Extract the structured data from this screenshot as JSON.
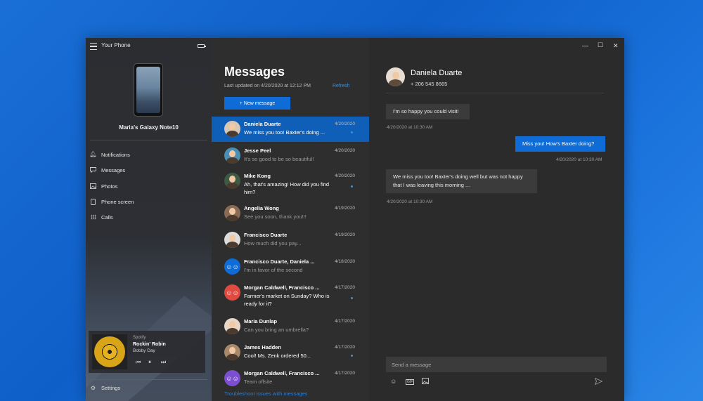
{
  "app": {
    "title": "Your Phone"
  },
  "sidebar": {
    "device_name": "Maria's Galaxy Note10",
    "items": [
      {
        "label": "Notifications",
        "icon": "bell-icon"
      },
      {
        "label": "Messages",
        "icon": "chat-icon"
      },
      {
        "label": "Photos",
        "icon": "photo-icon"
      },
      {
        "label": "Phone screen",
        "icon": "phone-screen-icon"
      },
      {
        "label": "Calls",
        "icon": "dialpad-icon"
      }
    ],
    "media": {
      "source": "Spotify",
      "song": "Rockin' Robin",
      "artist": "Bobby Day"
    },
    "settings_label": "Settings"
  },
  "messages": {
    "title": "Messages",
    "last_updated": "Last updated on 4/20/2020 at 12:12 PM",
    "refresh": "Refresh",
    "new_message": "+ New message",
    "troubleshoot": "Troubleshoot issues with messages",
    "conversations": [
      {
        "name": "Daniela Duarte",
        "date": "4/20/2020",
        "preview": "We miss you too! Baxter's doing ...",
        "unread": true,
        "selected": true,
        "avatar_color": "#d9c7b5"
      },
      {
        "name": "Jesse Peel",
        "date": "4/20/2020",
        "preview": "It's so good to be so beautiful!",
        "unread": false,
        "avatar_color": "#4a8fb8"
      },
      {
        "name": "Mike Kong",
        "date": "4/20/2020",
        "preview": "Ah, that's amazing! How did you find him?",
        "unread": true,
        "avatar_color": "#3d5a44"
      },
      {
        "name": "Angelia Wong",
        "date": "4/19/2020",
        "preview": "See you soon, thank you!!!",
        "unread": false,
        "avatar_color": "#8a6b56"
      },
      {
        "name": "Francisco Duarte",
        "date": "4/19/2020",
        "preview": "How much did you pay...",
        "unread": false,
        "avatar_color": "#dcdcdc"
      },
      {
        "name": "Francisco Duarte, Daniela ...",
        "date": "4/18/2020",
        "preview": "I'm in favor of the second",
        "unread": false,
        "avatar_color": "#0f6cd6",
        "group": true
      },
      {
        "name": "Morgan Caldwell, Francisco ...",
        "date": "4/17/2020",
        "preview": "Farmer's market on Sunday? Who is ready for it?",
        "unread": true,
        "avatar_color": "#e04a3f",
        "group": true
      },
      {
        "name": "Maria Dunlap",
        "date": "4/17/2020",
        "preview": "Can you bring an umbrella?",
        "unread": false,
        "avatar_color": "#e7d7c8"
      },
      {
        "name": "James Hadden",
        "date": "4/17/2020",
        "preview": "Cool! Ms. Zenk ordered 50...",
        "unread": true,
        "avatar_color": "#a88a6a"
      },
      {
        "name": "Morgan Caldwell, Francisco ...",
        "date": "4/17/2020",
        "preview": "Team offsite",
        "unread": false,
        "avatar_color": "#7b4fd0",
        "group": true
      }
    ]
  },
  "conversation": {
    "contact_name": "Daniela Duarte",
    "contact_phone": "+ 206 545 8665",
    "bubbles": [
      {
        "text": "I'm so happy you could visit!",
        "time": "4/20/2020 at 10:30 AM",
        "direction": "in"
      },
      {
        "text": "Miss you! How's Baxter doing?",
        "time": "4/20/2020 at 10:30 AM",
        "direction": "out"
      },
      {
        "text": "We miss you too! Baxter's doing well but was not happy that I was leaving this morning ...",
        "time": "4/20/2020 at 10:30 AM",
        "direction": "in"
      }
    ],
    "input_placeholder": "Send a message",
    "gif_label": "GIF"
  },
  "colors": {
    "accent": "#0f6cd6",
    "unread_dot": "#3d8fe0",
    "selected_row": "#0f5fb8"
  }
}
